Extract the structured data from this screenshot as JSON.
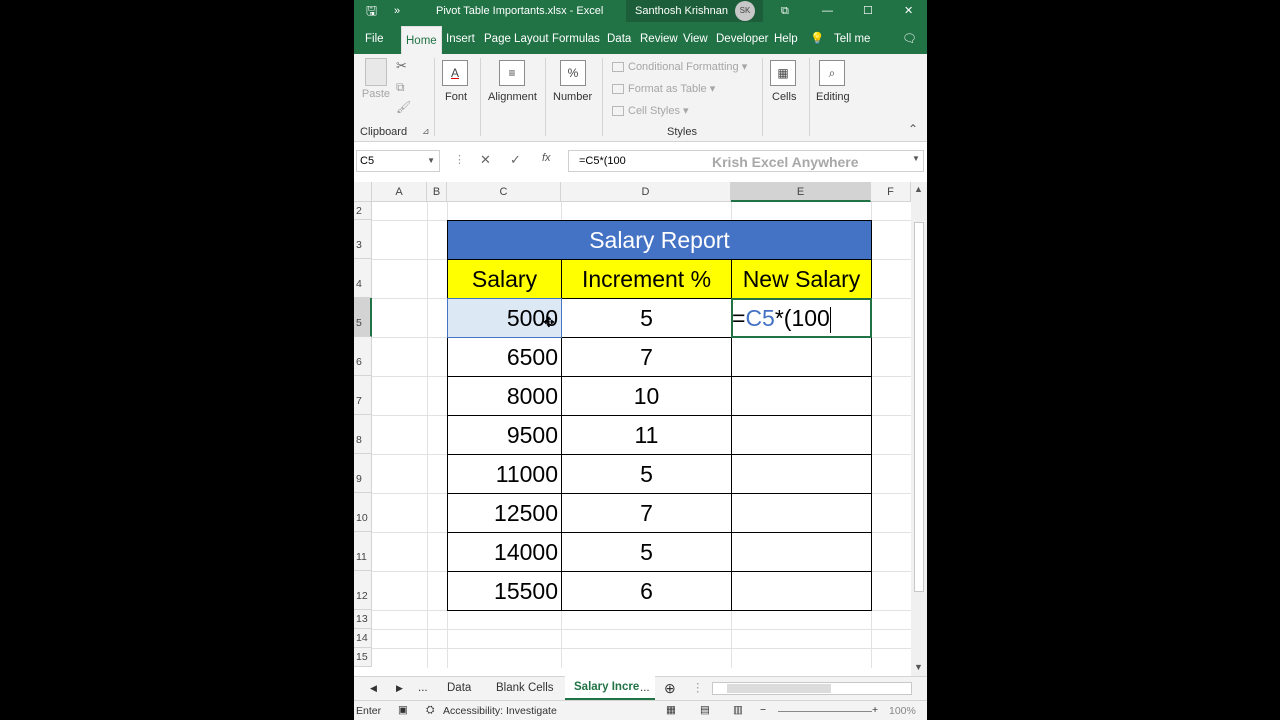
{
  "title_bar": {
    "file_title": "Pivot Table Importants.xlsx  -  Excel",
    "user_name": "Santhosh Krishnan",
    "user_initials": "SK",
    "more_glyph": "»",
    "minimize": "—",
    "maximize": "☐",
    "close": "✕",
    "ribbon_display": "⧉"
  },
  "tabs": [
    "File",
    "Home",
    "Insert",
    "Page Layout",
    "Formulas",
    "Data",
    "Review",
    "View",
    "Developer",
    "Help"
  ],
  "tell_me": "Tell me",
  "ribbon": {
    "paste": "Paste",
    "clipboard": "Clipboard",
    "font": "Font",
    "font_icon": "A",
    "alignment": "Alignment",
    "alignment_icon": "≡",
    "number": "Number",
    "number_icon": "%",
    "conditional_formatting": "Conditional Formatting",
    "format_as_table": "Format as Table",
    "cell_styles": "Cell Styles",
    "styles": "Styles",
    "cells": "Cells",
    "cells_icon": "▦",
    "editing": "Editing",
    "editing_icon": "⌕"
  },
  "formula_bar": {
    "name_box": "C5",
    "formula": "=C5*(100",
    "watermark": "Krish Excel Anywhere",
    "cancel": "✕",
    "enter": "✓",
    "fx": "fx"
  },
  "columns": [
    "A",
    "B",
    "C",
    "D",
    "E",
    "F"
  ],
  "rows": [
    "2",
    "3",
    "4",
    "5",
    "6",
    "7",
    "8",
    "9",
    "10",
    "11",
    "12",
    "13",
    "14",
    "15"
  ],
  "table": {
    "title": "Salary Report",
    "headers": [
      "Salary",
      "Increment %",
      "New Salary"
    ],
    "salary": [
      "5000",
      "6500",
      "8000",
      "9500",
      "11000",
      "12500",
      "14000",
      "15500"
    ],
    "increment": [
      "5",
      "7",
      "10",
      "11",
      "5",
      "7",
      "5",
      "6"
    ],
    "editing_prefix": "=",
    "editing_ref": "C5",
    "editing_rest": "*(100",
    "title_bg": "#4472c4",
    "header_bg": "#ffff00",
    "ref_color": "#4472c4"
  },
  "sheets": {
    "ellipsis": "...",
    "tabs": [
      "Data",
      "Blank Cells",
      "Salary Incre"
    ],
    "more": "...",
    "add": "⊕"
  },
  "status": {
    "mode": "Enter",
    "accessibility": "Accessibility: Investigate",
    "zoom": "100%"
  }
}
